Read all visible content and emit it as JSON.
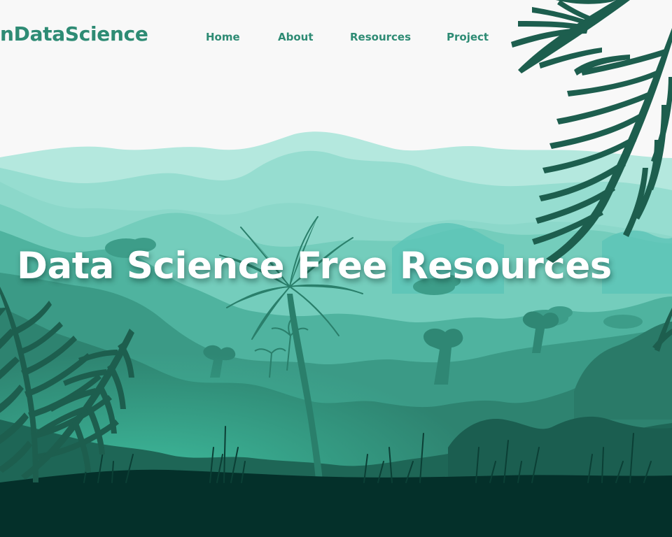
{
  "nav": {
    "logo": "nDataScience",
    "links": [
      "Home",
      "About",
      "Resources",
      "Project"
    ]
  },
  "hero": {
    "title": "Data Science Free Resources"
  },
  "colors": {
    "brand": "#2e8b74",
    "background": "#f8f8f8",
    "hero_text": "#ffffff",
    "ground": "#04302a"
  },
  "illustration": {
    "subject": "tropical-jungle-landscape"
  }
}
